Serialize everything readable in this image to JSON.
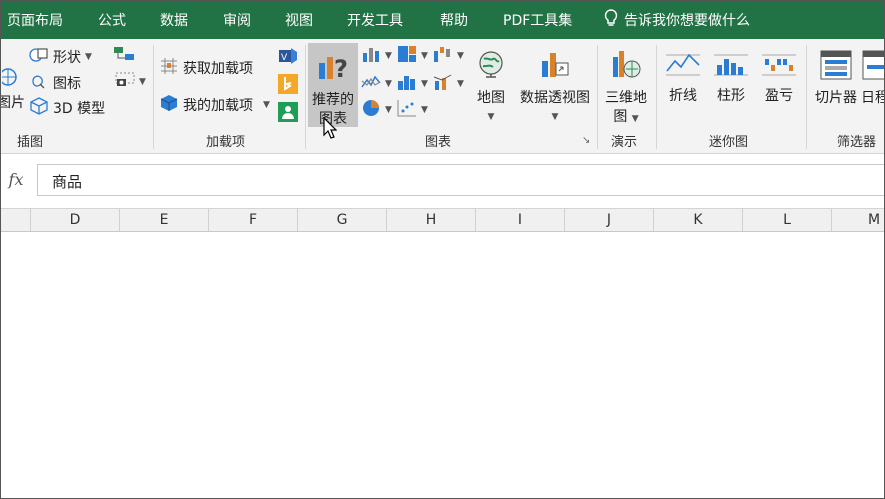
{
  "tabs": [
    "页面布局",
    "公式",
    "数据",
    "审阅",
    "视图",
    "开发工具",
    "帮助",
    "PDF工具集"
  ],
  "tell_me": "告诉我你想要做什么",
  "ribbon": {
    "illustrations": {
      "picture_fragment": "图片",
      "shapes": "形状",
      "icons": "图标",
      "model3d": "3D 模型",
      "label": "插图"
    },
    "addins": {
      "get": "获取加载项",
      "mine": "我的加载项",
      "label": "加载项"
    },
    "charts": {
      "recommended_line1": "推荐的",
      "recommended_line2": "图表",
      "map": "地图",
      "pivot_chart": "数据透视图",
      "label": "图表"
    },
    "tours": {
      "map3d_line1": "三维地",
      "map3d_line2": "图",
      "label": "演示"
    },
    "sparklines": {
      "line": "折线",
      "column": "柱形",
      "winloss": "盈亏",
      "label": "迷你图"
    },
    "filters": {
      "slicer": "切片器",
      "timeline_fragment": "日程",
      "label": "筛选器"
    }
  },
  "formula_bar": {
    "fx": "fx",
    "value": "商品"
  },
  "columns": [
    "D",
    "E",
    "F",
    "G",
    "H",
    "I",
    "J",
    "K",
    "L",
    "M"
  ],
  "colors": {
    "accent": "#217346",
    "ribbon_bg": "#f3f3f3",
    "selected": "#c6c6c6"
  }
}
